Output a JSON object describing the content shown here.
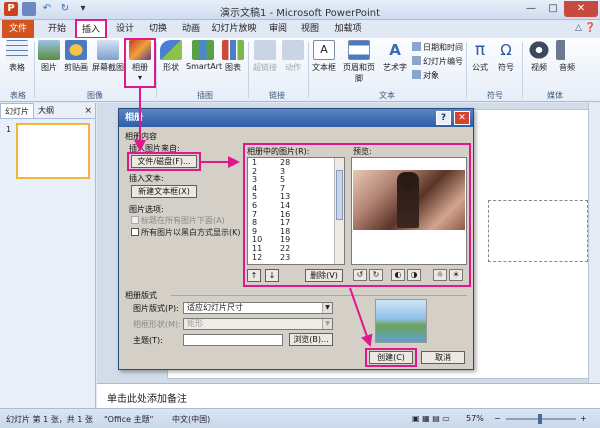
{
  "window": {
    "title": "演示文稿1 - Microsoft PowerPoint",
    "app_icon": "P",
    "qat_icons": [
      "save-icon",
      "undo-icon",
      "redo-icon",
      "customize-icon"
    ]
  },
  "tabs": [
    "文件",
    "开始",
    "插入",
    "设计",
    "切换",
    "动画",
    "幻灯片放映",
    "审阅",
    "视图",
    "加载项"
  ],
  "ribbon": {
    "buttons": {
      "table": "表格",
      "picture": "图片",
      "clipart": "剪贴画",
      "screenshot": "屏幕截图",
      "album": "相册",
      "shapes": "形状",
      "smartart": "SmartArt",
      "chart": "图表",
      "hyperlink": "超链接",
      "action": "动作",
      "textbox": "文本框",
      "header_footer": "页眉和页脚",
      "wordart": "艺术字",
      "datetime": "日期和时间",
      "slide_number": "幻灯片编号",
      "object": "对象",
      "equation": "公式",
      "symbol": "符号",
      "video": "视频",
      "audio": "音频"
    },
    "groups": [
      "表格",
      "图像",
      "插图",
      "链接",
      "文本",
      "符号",
      "媒体"
    ],
    "colors": {
      "accent": "#e0188c",
      "file_tab": "#d2531f"
    }
  },
  "left_panel": {
    "tabs": [
      "幻灯片",
      "大纲"
    ],
    "close": "×",
    "slide_number": "1"
  },
  "notes_placeholder": "单击此处添加备注",
  "status": {
    "slide_info": "幻灯片 第 1 张，共 1 张",
    "theme": "\"Office 主题\"",
    "language": "中文(中国)",
    "zoom": "57%"
  },
  "dialog": {
    "title": "相册",
    "help": "?",
    "close": "✕",
    "album_content_label": "相册内容",
    "insert_from_label": "插入图片来自:",
    "file_disk_button": "文件/磁盘(F)...",
    "insert_text_label": "插入文本:",
    "new_textbox_button": "新建文本框(X)",
    "picture_options_label": "图片选项:",
    "caption_below_all": "标题在所有图片下面(A)",
    "all_black_white": "所有图片以黑白方式显示(K)",
    "pictures_in_album_label": "相册中的图片(R):",
    "preview_label": "预览:",
    "pictures_col1": [
      "1",
      "2",
      "3",
      "4",
      "5",
      "6",
      "7",
      "8",
      "9",
      "10",
      "11",
      "12"
    ],
    "pictures_col2": [
      "28",
      "3",
      "5",
      "7",
      "13",
      "14",
      "16",
      "17",
      "18",
      "19",
      "22",
      "23"
    ],
    "remove_button": "删除(V)",
    "move_up": "↑",
    "move_down": "↓",
    "album_layout_label": "相册版式",
    "picture_layout_label": "图片版式(P):",
    "picture_layout_value": "适应幻灯片尺寸",
    "frame_shape_label": "相框形状(M):",
    "frame_shape_value": "矩形",
    "theme_label": "主题(T):",
    "browse_button": "浏览(B)...",
    "create_button": "创建(C)",
    "cancel_button": "取消"
  }
}
